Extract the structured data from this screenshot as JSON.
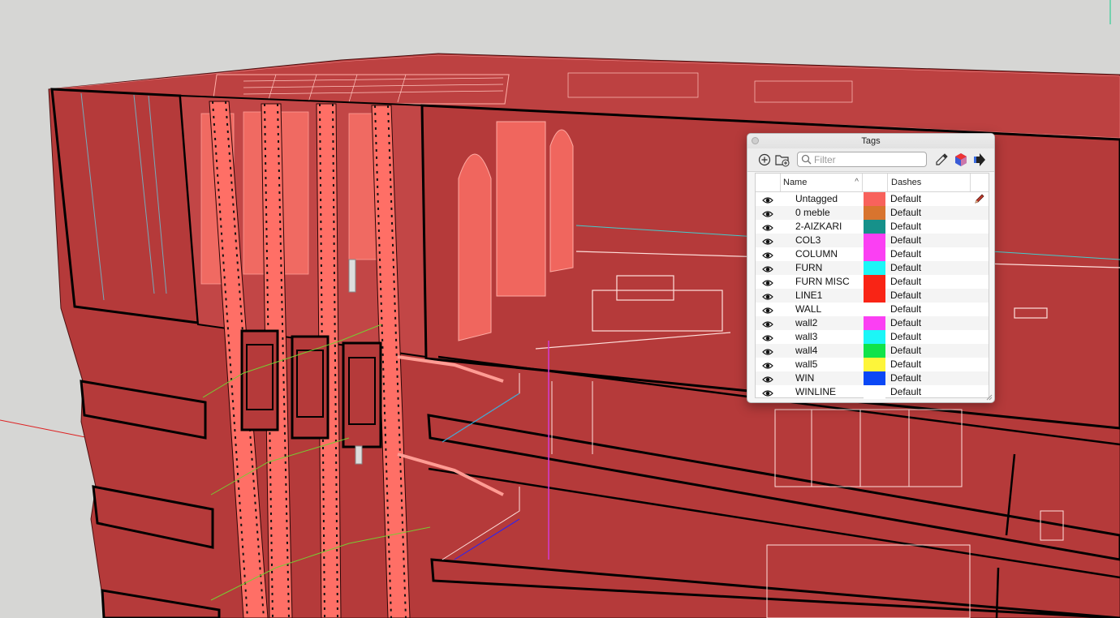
{
  "panel": {
    "title": "Tags",
    "filter_placeholder": "Filter",
    "columns": {
      "name": "Name",
      "dashes": "Dashes"
    },
    "toolbar_icons": [
      "add-tag-icon",
      "add-folder-icon",
      "search-icon",
      "eyedropper-icon",
      "color-by-tag-icon",
      "details-arrow-icon"
    ]
  },
  "tags": [
    {
      "name": "Untagged",
      "color": "#f8625c",
      "dashes": "Default",
      "active": true
    },
    {
      "name": "0 meble",
      "color": "#d8742e",
      "dashes": "Default"
    },
    {
      "name": "2-AIZKARI",
      "color": "#16918a",
      "dashes": "Default"
    },
    {
      "name": "COL3",
      "color": "#fb3ff3",
      "dashes": "Default"
    },
    {
      "name": "COLUMN",
      "color": "#fb3ff3",
      "dashes": "Default"
    },
    {
      "name": "FURN",
      "color": "#1cf6f7",
      "dashes": "Default"
    },
    {
      "name": "FURN MISC",
      "color": "#f92415",
      "dashes": "Default"
    },
    {
      "name": "LINE1",
      "color": "#f92415",
      "dashes": "Default"
    },
    {
      "name": "WALL",
      "color": "#ffffff",
      "dashes": "Default"
    },
    {
      "name": "wall2",
      "color": "#fb3ff3",
      "dashes": "Default"
    },
    {
      "name": "wall3",
      "color": "#1cf6f7",
      "dashes": "Default"
    },
    {
      "name": "wall4",
      "color": "#10e34a",
      "dashes": "Default"
    },
    {
      "name": "wall5",
      "color": "#fdf53a",
      "dashes": "Default"
    },
    {
      "name": "WIN",
      "color": "#0b48f5",
      "dashes": "Default"
    },
    {
      "name": "WINLINE",
      "color": "#ffffff",
      "dashes": "Default"
    }
  ],
  "model": {
    "face_color": "#b53a3a",
    "highlight_color": "#ff6a60"
  }
}
